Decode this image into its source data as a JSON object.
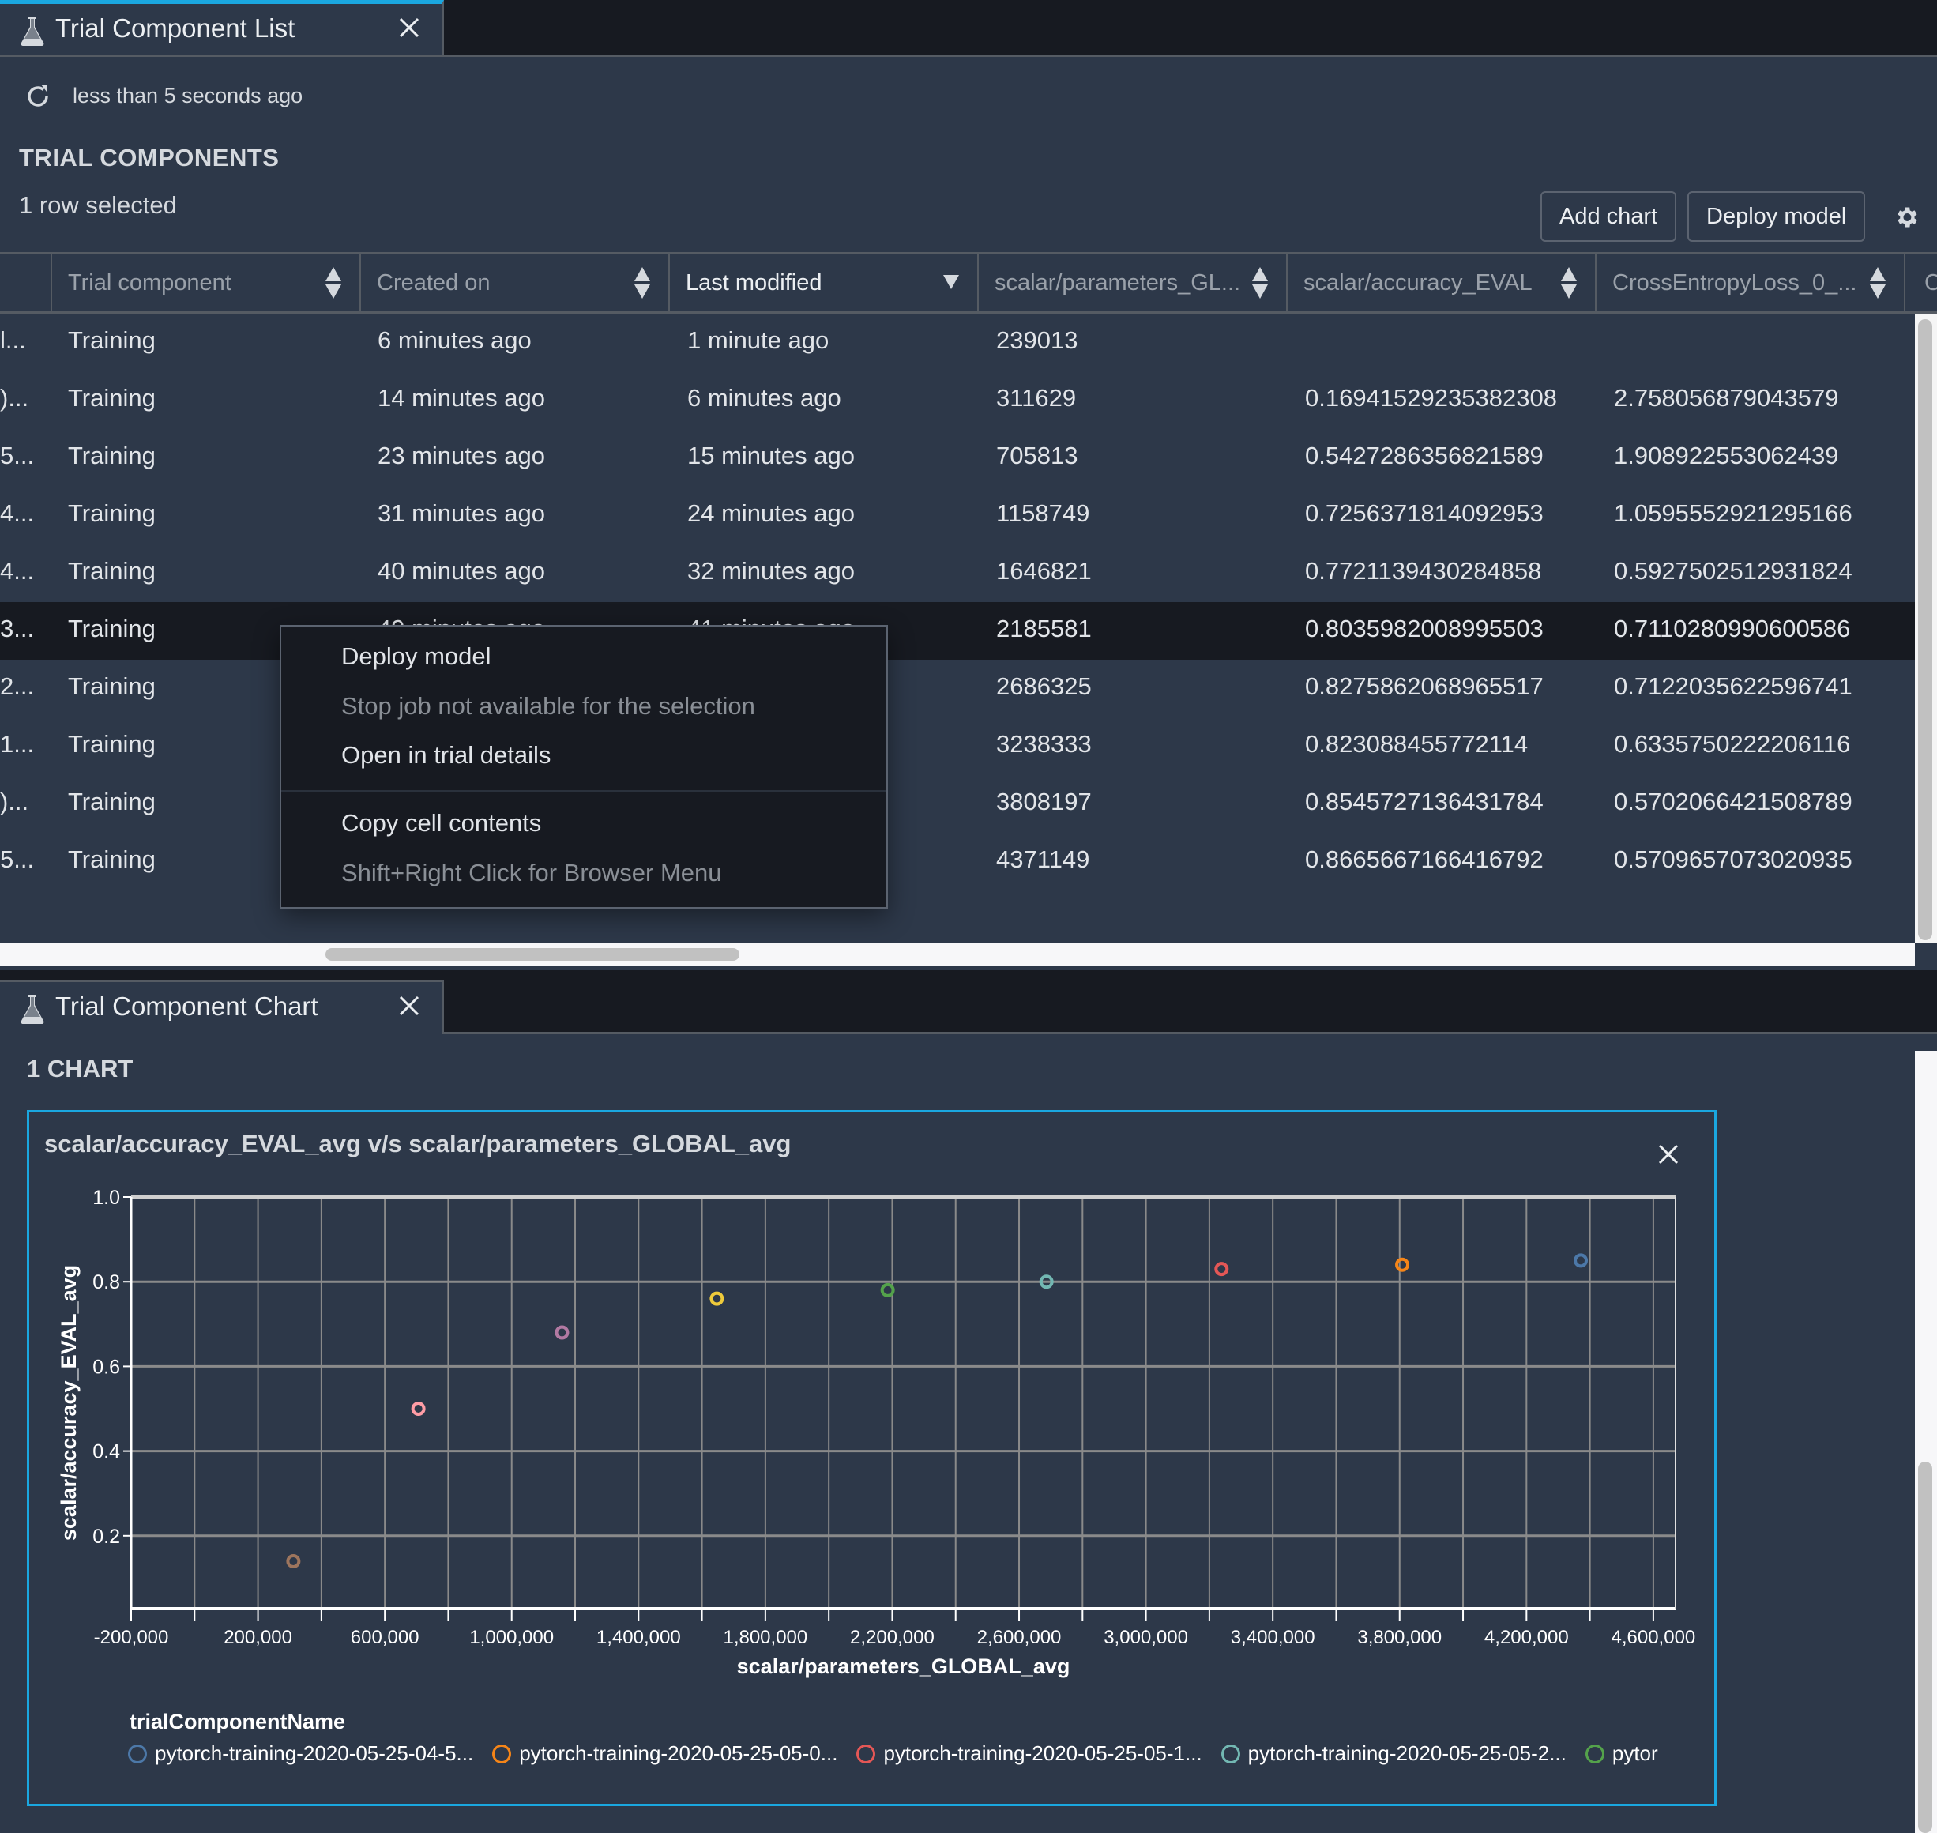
{
  "list_panel": {
    "tab_title": "Trial Component List",
    "tab_icon": "flask-icon",
    "refresh_status": "less than 5 seconds ago",
    "section_title": "TRIAL COMPONENTS",
    "selection_status": "1 row selected",
    "buttons": {
      "add_chart": "Add chart",
      "deploy_model": "Deploy model"
    },
    "columns": [
      {
        "label": "",
        "sort": "none"
      },
      {
        "label": "Trial component",
        "sort": "both"
      },
      {
        "label": "Created on",
        "sort": "both"
      },
      {
        "label": "Last modified",
        "sort": "desc"
      },
      {
        "label": "scalar/parameters_GL...",
        "sort": "both"
      },
      {
        "label": "scalar/accuracy_EVAL",
        "sort": "both"
      },
      {
        "label": "CrossEntropyLoss_0_...",
        "sort": "both"
      },
      {
        "label": "C",
        "sort": "none"
      }
    ],
    "rows": [
      {
        "name": "l...",
        "type": "Training",
        "created": "6 minutes ago",
        "modified": "1 minute ago",
        "params": "239013",
        "accuracy": "",
        "loss": ""
      },
      {
        "name": ")...",
        "type": "Training",
        "created": "14 minutes ago",
        "modified": "6 minutes ago",
        "params": "311629",
        "accuracy": "0.16941529235382308",
        "loss": "2.758056879043579"
      },
      {
        "name": "5...",
        "type": "Training",
        "created": "23 minutes ago",
        "modified": "15 minutes ago",
        "params": "705813",
        "accuracy": "0.5427286356821589",
        "loss": "1.908922553062439"
      },
      {
        "name": "4...",
        "type": "Training",
        "created": "31 minutes ago",
        "modified": "24 minutes ago",
        "params": "1158749",
        "accuracy": "0.7256371814092953",
        "loss": "1.0595552921295166"
      },
      {
        "name": "4...",
        "type": "Training",
        "created": "40 minutes ago",
        "modified": "32 minutes ago",
        "params": "1646821",
        "accuracy": "0.7721139430284858",
        "loss": "0.5927502512931824"
      },
      {
        "name": "3...",
        "type": "Training",
        "created": "49 minutes ago",
        "modified": "41 minutes ago",
        "params": "2185581",
        "accuracy": "0.8035982008995503",
        "loss": "0.7110280990600586",
        "selected": true
      },
      {
        "name": "2...",
        "type": "Training",
        "created": "",
        "modified": "",
        "params": "2686325",
        "accuracy": "0.8275862068965517",
        "loss": "0.7122035622596741"
      },
      {
        "name": "1...",
        "type": "Training",
        "created": "",
        "modified": "",
        "params": "3238333",
        "accuracy": "0.823088455772114",
        "loss": "0.6335750222206116"
      },
      {
        "name": ")...",
        "type": "Training",
        "created": "",
        "modified": "",
        "params": "3808197",
        "accuracy": "0.8545727136431784",
        "loss": "0.5702066421508789"
      },
      {
        "name": "5...",
        "type": "Training",
        "created": "",
        "modified": "",
        "params": "4371149",
        "accuracy": "0.8665667166416792",
        "loss": "0.5709657073020935"
      }
    ]
  },
  "context_menu": {
    "items": [
      {
        "label": "Deploy model",
        "enabled": true
      },
      {
        "label": "Stop job not available for the selection",
        "enabled": false
      },
      {
        "label": "Open in trial details",
        "enabled": true
      },
      {
        "label": "Copy cell contents",
        "enabled": true
      },
      {
        "label": "Shift+Right Click for Browser Menu",
        "enabled": false
      }
    ]
  },
  "chart_panel": {
    "tab_title": "Trial Component Chart",
    "chart_count": "1 CHART",
    "legend_title": "trialComponentName",
    "legend": [
      {
        "label": "pytorch-training-2020-05-25-04-5...",
        "color": "#4c78a8"
      },
      {
        "label": "pytorch-training-2020-05-25-05-0...",
        "color": "#f58518"
      },
      {
        "label": "pytorch-training-2020-05-25-05-1...",
        "color": "#e45756"
      },
      {
        "label": "pytorch-training-2020-05-25-05-2...",
        "color": "#72b7b2"
      },
      {
        "label": "pytor",
        "color": "#54a24b"
      }
    ]
  },
  "colors": {
    "panel_bg": "#2d3849",
    "accent": "#1aa7e0",
    "selected_row": "#171a21"
  },
  "chart_data": {
    "type": "scatter",
    "title": "scalar/accuracy_EVAL_avg v/s scalar/parameters_GLOBAL_avg",
    "xlabel": "scalar/parameters_GLOBAL_avg",
    "ylabel": "scalar/accuracy_EVAL_avg",
    "xlim": [
      -200000,
      4670000
    ],
    "ylim": [
      0.028,
      1.0
    ],
    "xticks": [
      -200000,
      0,
      200000,
      400000,
      600000,
      800000,
      1000000,
      1200000,
      1400000,
      1600000,
      1800000,
      2000000,
      2200000,
      2400000,
      2600000,
      2800000,
      3000000,
      3200000,
      3400000,
      3600000,
      3800000,
      4000000,
      4200000,
      4400000,
      4600000
    ],
    "xtick_labels": [
      "-200,000",
      "",
      "200,000",
      "",
      "600,000",
      "",
      "1,000,000",
      "",
      "1,400,000",
      "",
      "1,800,000",
      "",
      "2,200,000",
      "",
      "2,600,000",
      "",
      "3,000,000",
      "",
      "3,400,000",
      "",
      "3,800,000",
      "",
      "4,200,000",
      "",
      "4,600,000"
    ],
    "yticks": [
      0.2,
      0.4,
      0.6,
      0.8,
      1.0
    ],
    "ytick_labels": [
      "0.2",
      "0.4",
      "0.6",
      "0.8",
      "1.0"
    ],
    "grid": true,
    "legend_position": "bottom",
    "points": [
      {
        "x": 311629,
        "y": 0.14,
        "color": "#9d755d"
      },
      {
        "x": 705813,
        "y": 0.5,
        "color": "#ff9da6"
      },
      {
        "x": 1158749,
        "y": 0.68,
        "color": "#b279a2"
      },
      {
        "x": 1646821,
        "y": 0.76,
        "color": "#eeca3b"
      },
      {
        "x": 2185581,
        "y": 0.78,
        "color": "#54a24b"
      },
      {
        "x": 2686325,
        "y": 0.8,
        "color": "#72b7b2"
      },
      {
        "x": 3238333,
        "y": 0.83,
        "color": "#e45756"
      },
      {
        "x": 3808197,
        "y": 0.84,
        "color": "#f58518"
      },
      {
        "x": 4371149,
        "y": 0.85,
        "color": "#4c78a8"
      }
    ]
  }
}
